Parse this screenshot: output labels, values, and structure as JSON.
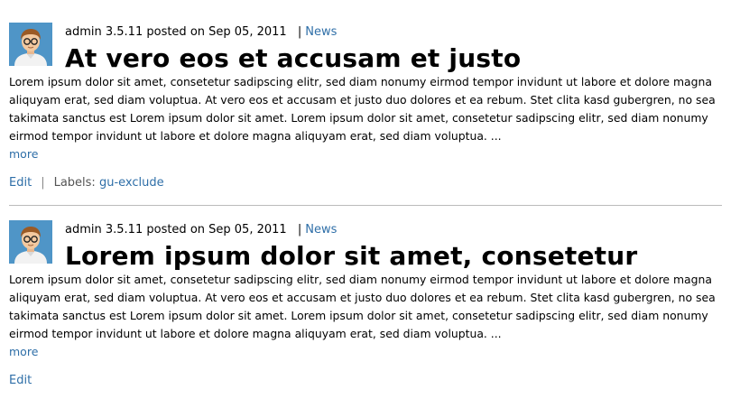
{
  "posts": [
    {
      "author": "admin 3.5.11",
      "posted_on": "posted on",
      "date": "Sep 05, 2011",
      "category": "News",
      "title": "At vero eos et accusam et justo",
      "body": "Lorem ipsum dolor sit amet, consetetur sadipscing elitr, sed diam nonumy eirmod tempor invidunt ut labore et dolore magna aliquyam erat, sed diam voluptua. At vero eos et accusam et justo duo dolores et ea rebum. Stet clita kasd gubergren, no sea takimata sanctus est Lorem ipsum dolor sit amet. Lorem ipsum dolor sit amet, consetetur sadipscing elitr, sed diam nonumy eirmod tempor invidunt ut labore et dolore magna aliquyam erat, sed diam voluptua. ...",
      "more": "more",
      "edit": "Edit",
      "labels_prefix": "Labels:",
      "label": "gu-exclude"
    },
    {
      "author": "admin 3.5.11",
      "posted_on": "posted on",
      "date": "Sep 05, 2011",
      "category": "News",
      "title": "Lorem ipsum dolor sit amet, consetetur",
      "body": "Lorem ipsum dolor sit amet, consetetur sadipscing elitr, sed diam nonumy eirmod tempor invidunt ut labore et dolore magna aliquyam erat, sed diam voluptua. At vero eos et accusam et justo duo dolores et ea rebum. Stet clita kasd gubergren, no sea takimata sanctus est Lorem ipsum dolor sit amet. Lorem ipsum dolor sit amet, consetetur sadipscing elitr, sed diam nonumy eirmod tempor invidunt ut labore et dolore magna aliquyam erat, sed diam voluptua. ...",
      "more": "more",
      "edit": "Edit"
    }
  ],
  "colors": {
    "link": "#2f6fa8",
    "avatar_bg": "#4f95c7",
    "divider": "#bbbbbb"
  }
}
